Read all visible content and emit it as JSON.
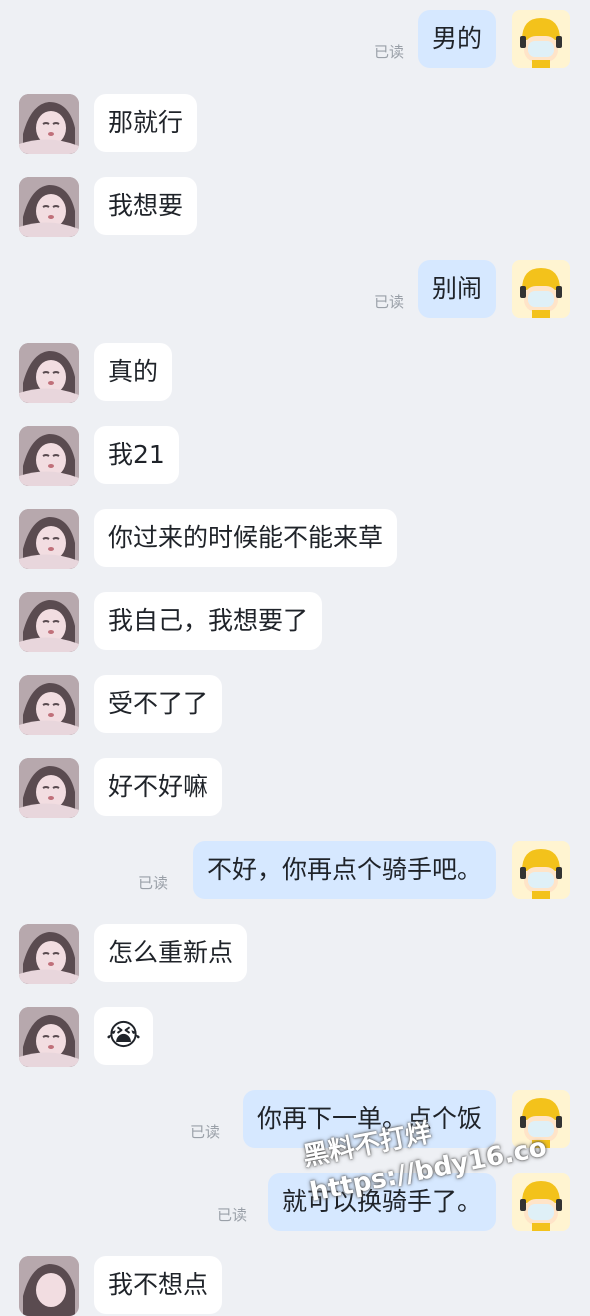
{
  "messages": [
    {
      "side": "out",
      "text": "男的",
      "read": "已读"
    },
    {
      "side": "in",
      "text": "那就行"
    },
    {
      "side": "in",
      "text": "我想要"
    },
    {
      "side": "out",
      "text": "别闹",
      "read": "已读"
    },
    {
      "side": "in",
      "text": "真的"
    },
    {
      "side": "in",
      "text": "我21"
    },
    {
      "side": "in",
      "text": "你过来的时候能不能来草"
    },
    {
      "side": "in",
      "text": "我自己，我想要了"
    },
    {
      "side": "in",
      "text": "受不了了"
    },
    {
      "side": "in",
      "text": "好不好嘛"
    },
    {
      "side": "out",
      "text": "不好，你再点个骑手吧。",
      "read": "已读"
    },
    {
      "side": "in",
      "text": "怎么重新点"
    },
    {
      "side": "in",
      "emoji": "😭"
    },
    {
      "side": "out",
      "text": "你再下一单。点个饭",
      "read": "已读"
    },
    {
      "side": "out",
      "text": "就可以换骑手了。",
      "read": "已读"
    },
    {
      "side": "in",
      "text": "我不想点"
    }
  ],
  "watermark": {
    "line1": "黑料不打烊",
    "line2": "https://bdy16.co"
  },
  "colors": {
    "background": "#eef0f4",
    "incoming_bubble": "#ffffff",
    "outgoing_bubble": "#d6e8ff",
    "read_text": "#9aa0a8"
  },
  "icons": {
    "incoming_avatar": "anime-girl-avatar",
    "outgoing_avatar": "rider-helmet-avatar"
  }
}
